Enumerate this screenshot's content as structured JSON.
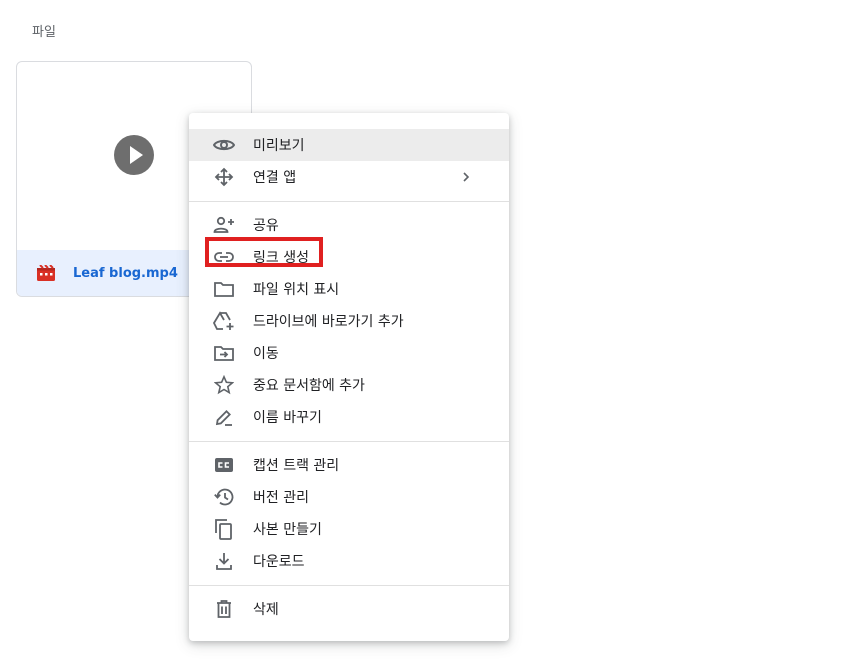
{
  "section": {
    "title": "파일"
  },
  "file": {
    "name": "Leaf blog.mp4",
    "icon": "video-file-icon",
    "icon_color": "#d93025"
  },
  "menu": {
    "items": [
      {
        "label": "미리보기",
        "icon": "eye-icon"
      },
      {
        "label": "연결 앱",
        "icon": "move-arrows-icon",
        "submenu": true
      },
      {
        "label": "공유",
        "icon": "person-add-icon"
      },
      {
        "label": "링크 생성",
        "icon": "link-icon"
      },
      {
        "label": "파일 위치 표시",
        "icon": "folder-icon"
      },
      {
        "label": "드라이브에 바로가기 추가",
        "icon": "drive-add-icon"
      },
      {
        "label": "이동",
        "icon": "folder-move-icon"
      },
      {
        "label": "중요 문서함에 추가",
        "icon": "star-icon"
      },
      {
        "label": "이름 바꾸기",
        "icon": "pencil-icon"
      },
      {
        "label": "캡션 트랙 관리",
        "icon": "closed-caption-icon"
      },
      {
        "label": "버전 관리",
        "icon": "history-icon"
      },
      {
        "label": "사본 만들기",
        "icon": "copy-icon"
      },
      {
        "label": "다운로드",
        "icon": "download-icon"
      },
      {
        "label": "삭제",
        "icon": "trash-icon"
      }
    ],
    "hovered_item": "미리보기",
    "highlighted_item": "링크 생성",
    "highlight_color": "#e02020"
  }
}
